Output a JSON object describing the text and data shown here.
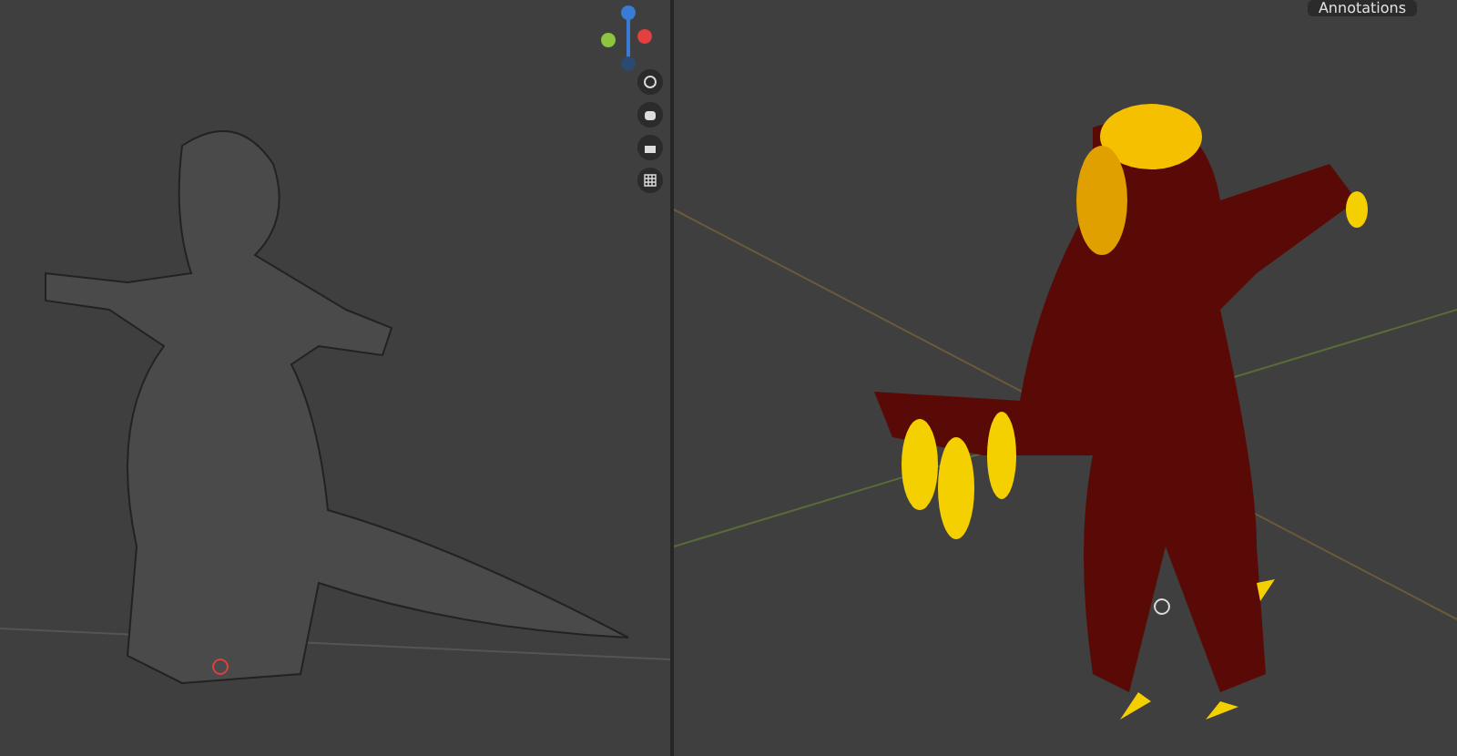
{
  "right_viewport": {
    "overlay_label": "Annotations"
  }
}
